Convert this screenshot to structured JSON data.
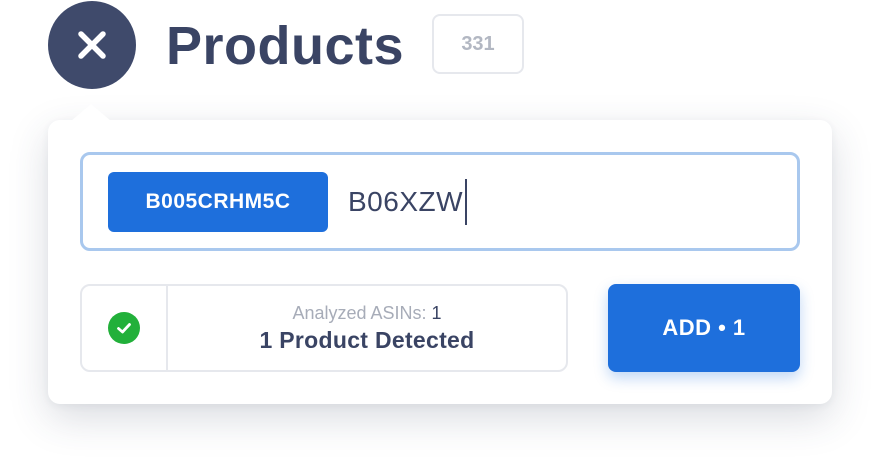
{
  "header": {
    "title": "Products",
    "count": "331",
    "close_icon": "close-icon"
  },
  "asin_input": {
    "chips": [
      "B005CRHM5C"
    ],
    "typed_value": "B06XZW"
  },
  "status": {
    "icon": "check-circle-icon",
    "analyzed_label": "Analyzed ASINs:",
    "analyzed_count": "1",
    "detected_text": "1 Product Detected"
  },
  "actions": {
    "add_label": "ADD • 1"
  },
  "colors": {
    "primary": "#1e6fdc",
    "dark_navy": "#3f4a6b",
    "success": "#22b03a",
    "input_focus_border": "#a9c8ee"
  }
}
